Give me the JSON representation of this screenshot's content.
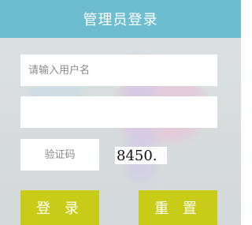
{
  "header": {
    "title": "管理员登录"
  },
  "form": {
    "username_placeholder": "请输入用户名",
    "username_value": "",
    "password_value": "",
    "captcha_placeholder": "验证码",
    "captcha_value": "",
    "captcha_image_text": "8450."
  },
  "buttons": {
    "login_label": "登 录",
    "reset_label": "重 置"
  },
  "colors": {
    "header": "#6bbdcf",
    "button": "#c8cc19",
    "field": "#ffffff"
  }
}
